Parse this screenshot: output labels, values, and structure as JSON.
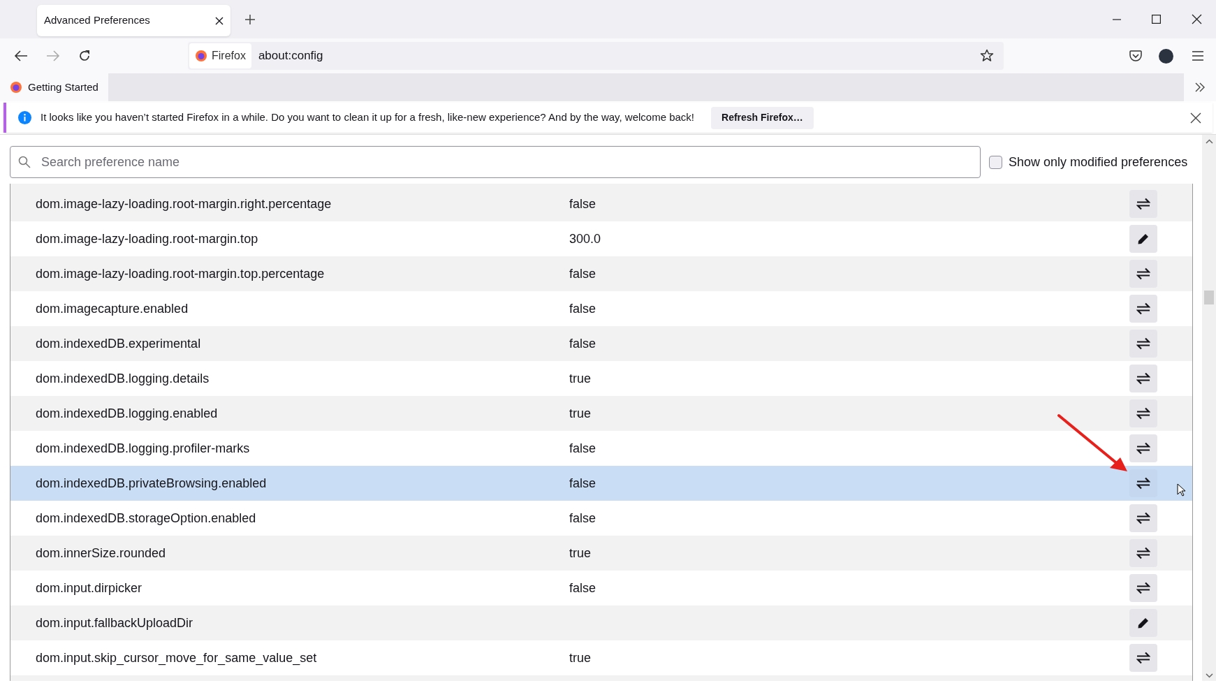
{
  "window": {
    "tab": {
      "title": "Advanced Preferences",
      "selected": true
    }
  },
  "url_bar": {
    "identity": "Firefox",
    "url": "about:config"
  },
  "bookmarks": [
    {
      "label": "Getting Started"
    }
  ],
  "notification": {
    "message": "It looks like you haven’t started Firefox in a while. Do you want to clean it up for a fresh, like-new experience? And by the way, welcome back!",
    "button": "Refresh Firefox…"
  },
  "search": {
    "placeholder": "Search preference name"
  },
  "show_modified": {
    "label": "Show only modified preferences",
    "checked": false
  },
  "rows": [
    {
      "name": "dom.image-lazy-loading.root-margin.right.percentage",
      "value": "false",
      "kind": "toggle",
      "selected": false
    },
    {
      "name": "dom.image-lazy-loading.root-margin.top",
      "value": "300.0",
      "kind": "edit",
      "selected": false
    },
    {
      "name": "dom.image-lazy-loading.root-margin.top.percentage",
      "value": "false",
      "kind": "toggle",
      "selected": false
    },
    {
      "name": "dom.imagecapture.enabled",
      "value": "false",
      "kind": "toggle",
      "selected": false
    },
    {
      "name": "dom.indexedDB.experimental",
      "value": "false",
      "kind": "toggle",
      "selected": false
    },
    {
      "name": "dom.indexedDB.logging.details",
      "value": "true",
      "kind": "toggle",
      "selected": false
    },
    {
      "name": "dom.indexedDB.logging.enabled",
      "value": "true",
      "kind": "toggle",
      "selected": false
    },
    {
      "name": "dom.indexedDB.logging.profiler-marks",
      "value": "false",
      "kind": "toggle",
      "selected": false
    },
    {
      "name": "dom.indexedDB.privateBrowsing.enabled",
      "value": "false",
      "kind": "toggle",
      "selected": true
    },
    {
      "name": "dom.indexedDB.storageOption.enabled",
      "value": "false",
      "kind": "toggle",
      "selected": false
    },
    {
      "name": "dom.innerSize.rounded",
      "value": "true",
      "kind": "toggle",
      "selected": false
    },
    {
      "name": "dom.input.dirpicker",
      "value": "false",
      "kind": "toggle",
      "selected": false
    },
    {
      "name": "dom.input.fallbackUploadDir",
      "kind": "edit",
      "selected": false
    },
    {
      "name": "dom.input.skip_cursor_move_for_same_value_set",
      "value": "true",
      "kind": "toggle",
      "selected": false
    }
  ]
}
